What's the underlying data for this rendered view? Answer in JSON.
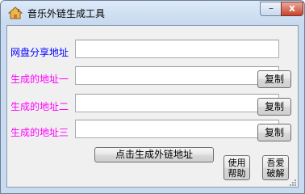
{
  "window": {
    "title": "音乐外链生成工具",
    "minimize_glyph": "–",
    "close_glyph": "x",
    "app_icon": "house-icon"
  },
  "form": {
    "share_label": "网盘分享地址",
    "share_value": "",
    "link1_label": "生成的地址一",
    "link1_value": "",
    "link2_label": "生成的地址二",
    "link2_value": "",
    "link3_label": "生成的地址三",
    "link3_value": "",
    "copy_label": "复制",
    "generate_label": "点击生成外链地址",
    "help_label": "使用\n帮助",
    "crack_label": "吾爱\n破解"
  },
  "colors": {
    "share_label": "#0000ff",
    "generated_labels": "#ff00ff",
    "close_button": "#c8422d"
  }
}
